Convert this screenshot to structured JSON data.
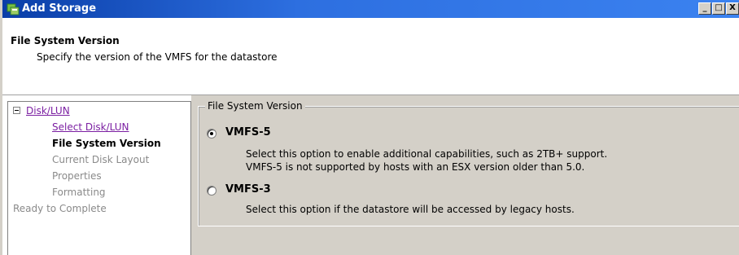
{
  "window": {
    "title": "Add Storage",
    "controls": {
      "minimize": "_",
      "maximize": "□",
      "close": "X"
    }
  },
  "header": {
    "title": "File System Version",
    "subtitle": "Specify the version of the VMFS for the datastore"
  },
  "sidebar": {
    "group_label": "Disk/LUN",
    "items": [
      {
        "label": "Select Disk/LUN",
        "state": "link"
      },
      {
        "label": "File System Version",
        "state": "current"
      },
      {
        "label": "Current Disk Layout",
        "state": "disabled"
      },
      {
        "label": "Properties",
        "state": "disabled"
      },
      {
        "label": "Formatting",
        "state": "disabled"
      }
    ],
    "final_item": "Ready to Complete"
  },
  "main": {
    "group_title": "File System Version",
    "options": [
      {
        "label": "VMFS-5",
        "selected": true,
        "desc1": "Select this option to enable additional capabilities, such as 2TB+ support.",
        "desc2": "VMFS-5 is not supported by hosts with an ESX version older than 5.0."
      },
      {
        "label": "VMFS-3",
        "selected": false,
        "desc1": "Select this option if the datastore will be accessed by legacy hosts."
      }
    ]
  },
  "colors": {
    "titlebar": "#2d6fe0",
    "link": "#7b1fa2",
    "panel": "#d4d0c8"
  }
}
